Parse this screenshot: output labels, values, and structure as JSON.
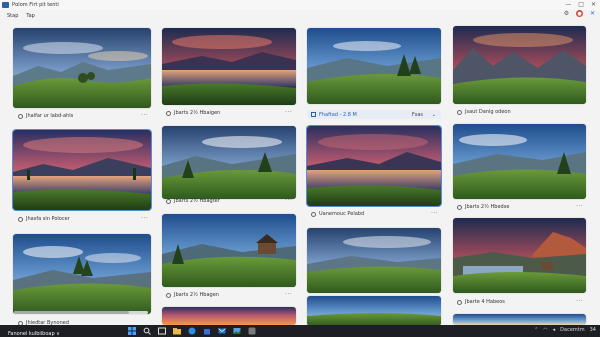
{
  "window": {
    "title": "Pαlom Fіrt pit tenti",
    "min_glyph": "—",
    "max_glyph": "□",
    "close_glyph": "✕"
  },
  "menu": {
    "items": [
      {
        "label": "Stap"
      },
      {
        "label": "Tap"
      }
    ]
  },
  "toolbar": {
    "settings_glyph": "⚙",
    "record_glyph": "●",
    "pin_glyph": "✕"
  },
  "captions": {
    "c1": "Jhalfar ur labd-ahls",
    "c2": "Jbarts 2½ Hbaigen",
    "c3": "Jsaut Danig odeon",
    "c4": "Jhasfa sin Polocer",
    "c5": "Jbarts 2½ Hbagter",
    "c6": "Uanemouc Pelabd",
    "c7": "Jbarts 2½ Hbedse",
    "c8": "Jbarts 2½ Hbagen",
    "c9": "Jbarte 4 Habeos",
    "c10": "Jhiedtar Bynoned",
    "more_glyph": "···"
  },
  "tagbar": {
    "label": "Fhaftad  -  2.8 M",
    "sync": "Fsas",
    "chevron": "⌄"
  },
  "footer": {
    "left_label": "Fanonel kulbiiboap ∨"
  },
  "taskbar": {
    "time": "Dacemtm",
    "date": "34"
  }
}
